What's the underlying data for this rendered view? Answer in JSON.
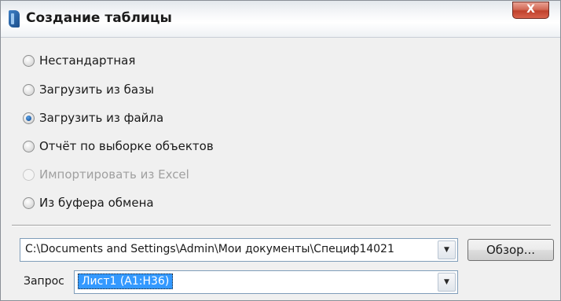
{
  "window": {
    "title": "Создание таблицы",
    "close_symbol": "X"
  },
  "options": [
    {
      "label": "Нестандартная",
      "checked": false,
      "enabled": true
    },
    {
      "label": "Загрузить из базы",
      "checked": false,
      "enabled": true
    },
    {
      "label": "Загрузить из файла",
      "checked": true,
      "enabled": true
    },
    {
      "label": "Отчёт по выборке объектов",
      "checked": false,
      "enabled": true
    },
    {
      "label": "Импортировать из Excel",
      "checked": false,
      "enabled": false
    },
    {
      "label": "Из буфера обмена",
      "checked": false,
      "enabled": true
    }
  ],
  "file": {
    "path": "C:\\Documents and Settings\\Admin\\Мои документы\\Специф14021",
    "browse_label": "Обзор..."
  },
  "query": {
    "label": "Запрос",
    "value": "Лист1 (A1:H36)"
  },
  "icons": {
    "app": "app-icon",
    "close": "close-icon",
    "dropdown": "chevron-down-icon"
  }
}
